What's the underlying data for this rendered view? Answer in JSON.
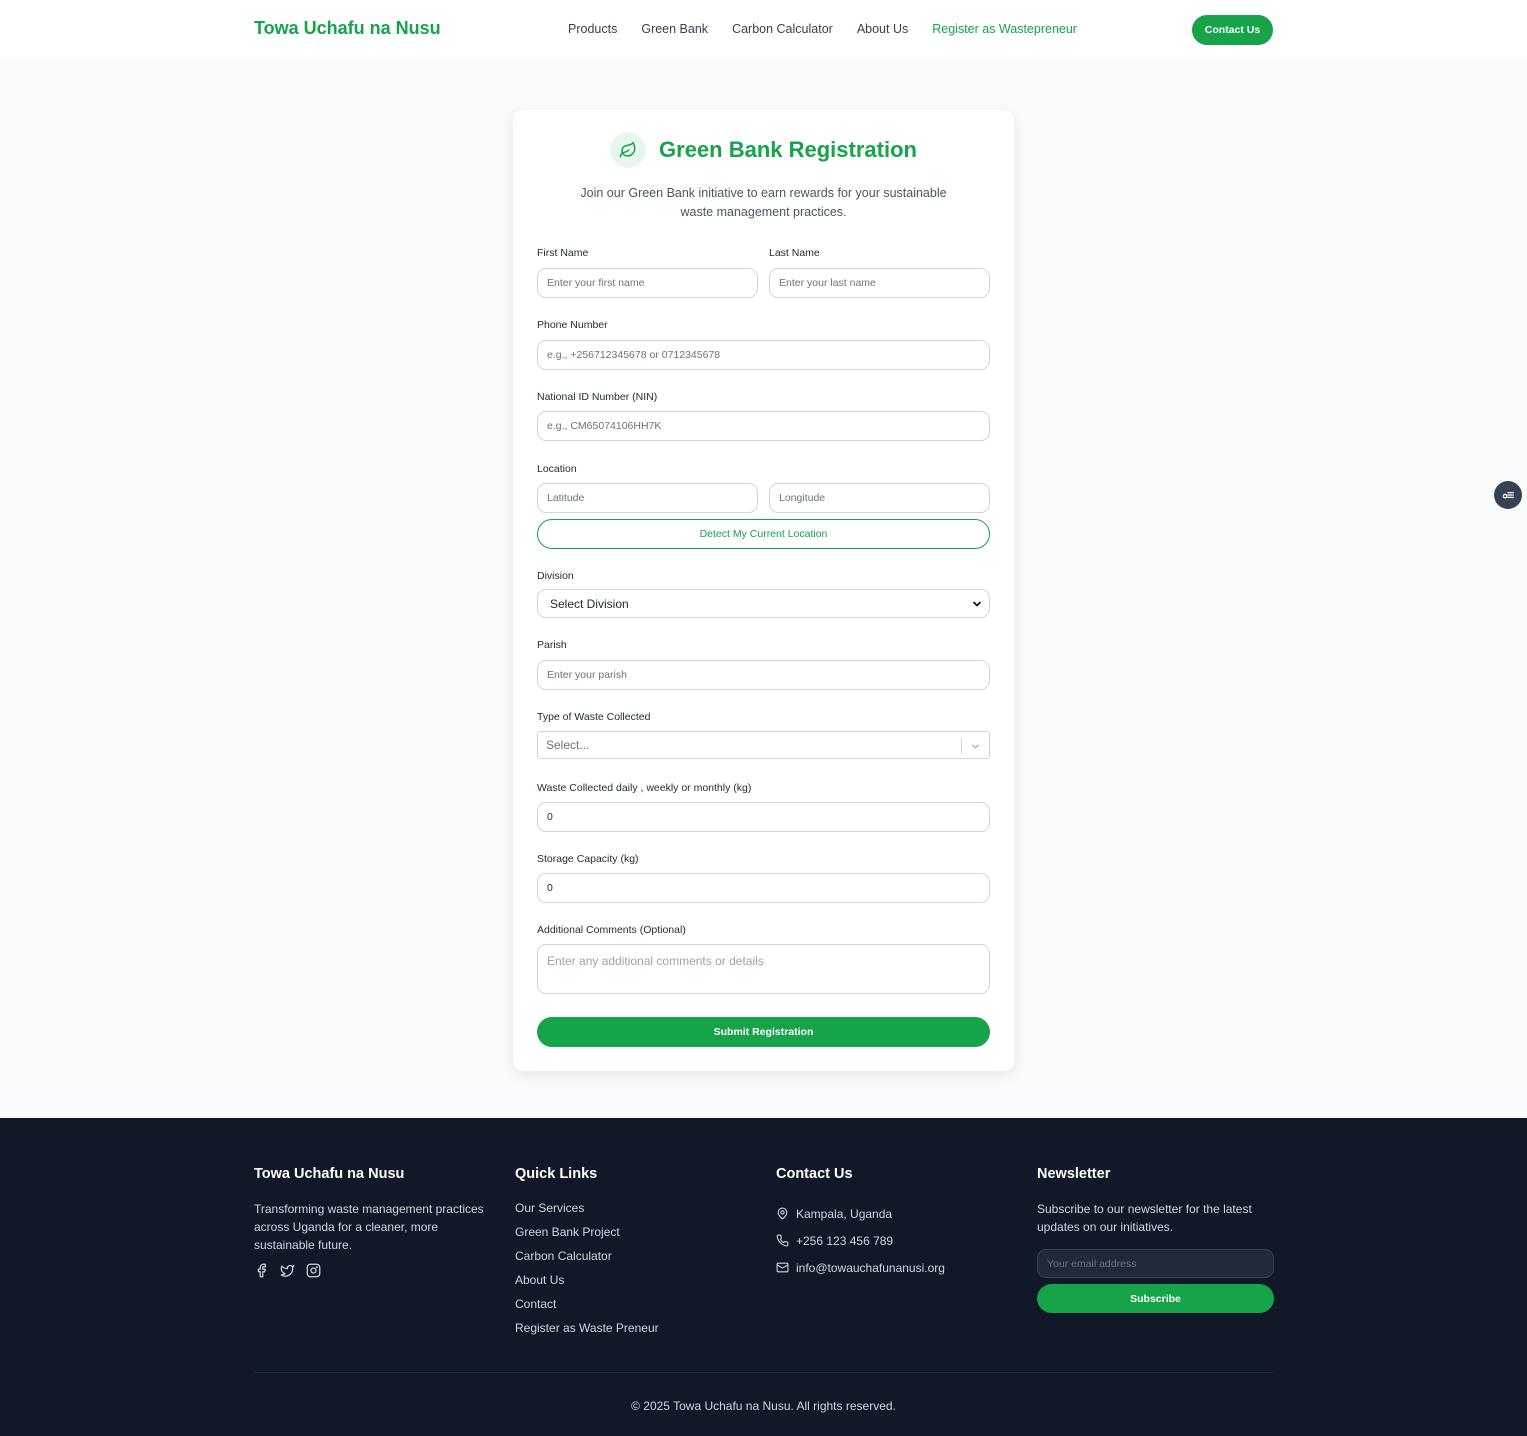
{
  "header": {
    "brand": "Towa Uchafu na Nusu",
    "nav": [
      "Products",
      "Green Bank",
      "Carbon Calculator",
      "About Us",
      "Register as Wastepreneur"
    ],
    "contact_button": "Contact Us"
  },
  "form": {
    "title": "Green Bank Registration",
    "subtitle": "Join our Green Bank initiative to earn rewards for your sustainable waste management practices.",
    "first_name_label": "First Name",
    "first_name_placeholder": "Enter your first name",
    "last_name_label": "Last Name",
    "last_name_placeholder": "Enter your last name",
    "phone_label": "Phone Number",
    "phone_placeholder": "e.g., +256712345678 or 0712345678",
    "nin_label": "National ID Number (NIN)",
    "nin_placeholder": "e.g., CM65074106HH7K",
    "location_label": "Location",
    "latitude_placeholder": "Latitude",
    "longitude_placeholder": "Longitude",
    "detect_button": "Detect My Current Location",
    "division_label": "Division",
    "division_value": "Select Division",
    "parish_label": "Parish",
    "parish_placeholder": "Enter your parish",
    "waste_type_label": "Type of Waste Collected",
    "waste_type_placeholder": "Select...",
    "waste_collected_label": "Waste Collected daily , weekly or monthly (kg)",
    "waste_collected_value": "0",
    "storage_label": "Storage Capacity (kg)",
    "storage_value": "0",
    "comments_label": "Additional Comments (Optional)",
    "comments_placeholder": "Enter any additional comments or details",
    "submit_button": "Submit Registration"
  },
  "footer": {
    "about_title": "Towa Uchafu na Nusu",
    "about_text": "Transforming waste management practices across Uganda for a cleaner, more sustainable future.",
    "quick_links_title": "Quick Links",
    "quick_links": [
      "Our Services",
      "Green Bank Project",
      "Carbon Calculator",
      "About Us",
      "Contact",
      "Register as Waste Preneur"
    ],
    "contact_title": "Contact Us",
    "address": "Kampala, Uganda",
    "phone": "+256 123 456 789",
    "email": "info@towauchafunanusi.org",
    "newsletter_title": "Newsletter",
    "newsletter_text": "Subscribe to our newsletter for the latest updates on our initiatives.",
    "newsletter_placeholder": "Your email address",
    "subscribe_button": "Subscribe",
    "copyright": "© 2025 Towa Uchafu na Nusu. All rights reserved."
  },
  "colors": {
    "accent": "#16a34a",
    "footer_bg": "#111827"
  }
}
